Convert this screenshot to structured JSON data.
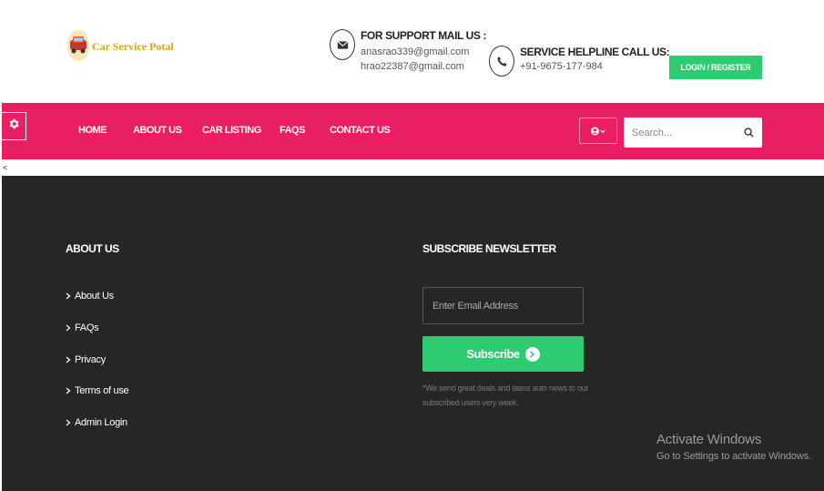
{
  "header": {
    "logo_text": "Car Service Potal",
    "support": {
      "title": "FOR SUPPORT MAIL US :",
      "emails": [
        "anasrao339@gmail.com",
        "hrao22387@gmail.com"
      ]
    },
    "helpline": {
      "title": "SERVICE HELPLINE CALL US:",
      "phone": "+91-9675-177-984"
    },
    "login_label": "LOGIN / REGISTER"
  },
  "navbar": {
    "items": [
      "HOME",
      "ABOUT US",
      "CAR LISTING",
      "FAQS",
      "CONTACT US"
    ],
    "search_placeholder": "Search..."
  },
  "back_link": "<",
  "footer": {
    "about_heading": "ABOUT US",
    "links": [
      "About Us",
      "FAQs",
      "Privacy",
      "Terms of use",
      "Admin Login"
    ],
    "newsletter_heading": "SUBSCRIBE NEWSLETTER",
    "email_placeholder": "Enter Email Address",
    "subscribe_label": "Subscribe",
    "note": "*We send great deals and latest auto news to our subscribed users very week."
  },
  "watermark": {
    "line1": "Activate Windows",
    "line2": "Go to Settings to activate Windows."
  },
  "colors": {
    "brand_pink": "#ea1f63",
    "accent_green": "#2ecc71",
    "footer_bg": "#262626",
    "logo_gold": "#d9a41f"
  },
  "icons": [
    "logo-icon",
    "envelope-icon",
    "phone-icon",
    "gear-icon",
    "user-icon",
    "chevron-down-icon",
    "search-icon",
    "chevron-right-icon",
    "arrow-right-icon"
  ]
}
